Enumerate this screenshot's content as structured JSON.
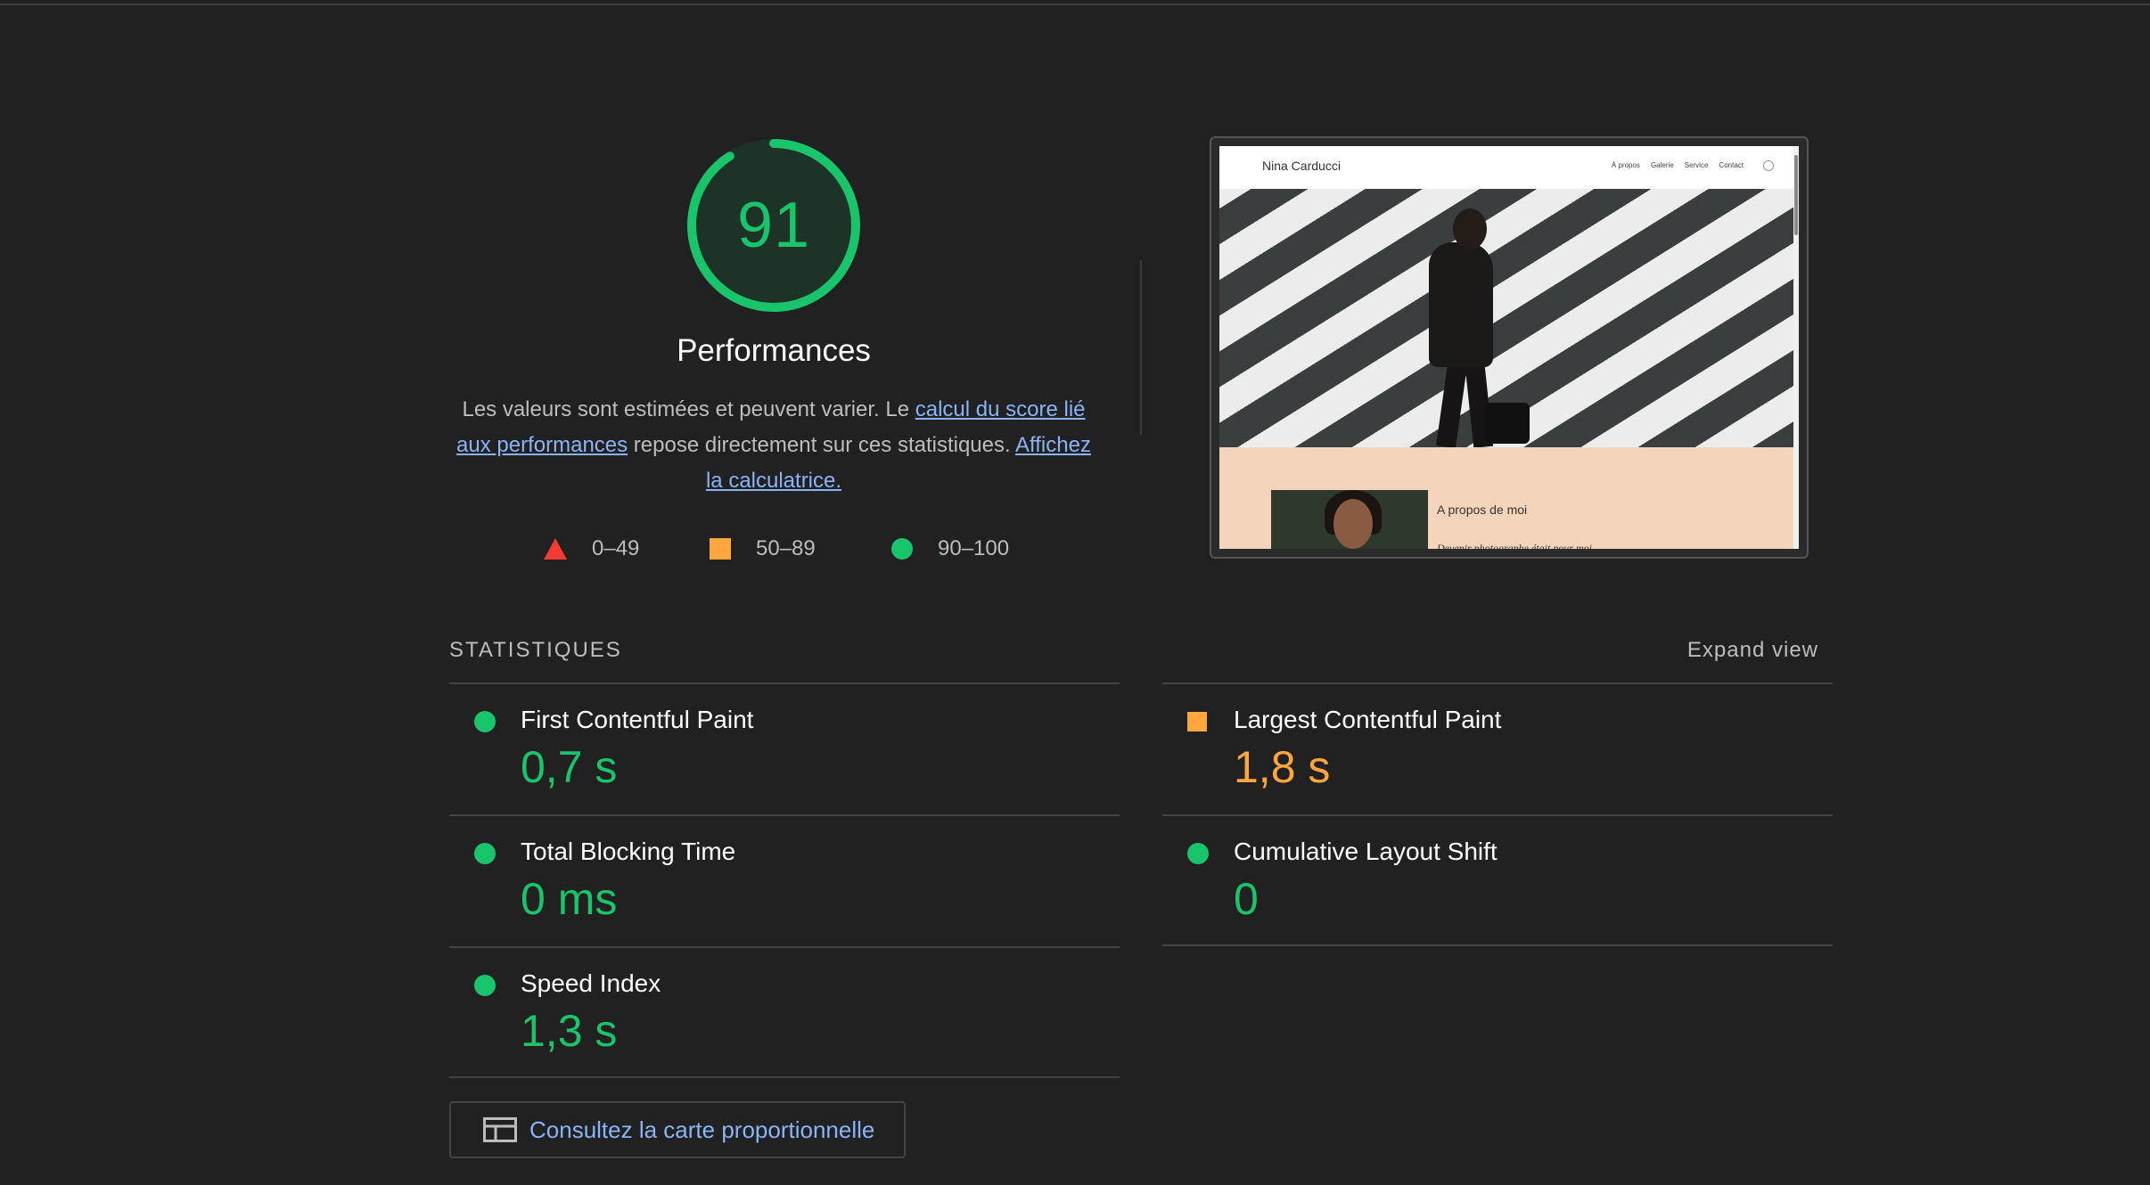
{
  "score": {
    "value": "91",
    "fraction": 0.91,
    "title": "Performances",
    "color": "#19c56a"
  },
  "description": {
    "part1": "Les valeurs sont estimées et peuvent varier. Le ",
    "link1": "calcul du score lié aux performances",
    "part2": " repose directement sur ces statistiques. ",
    "link2": "Affichez la calculatrice."
  },
  "legend": [
    {
      "range": "0–49",
      "shape": "triangle",
      "color": "#f33a33"
    },
    {
      "range": "50–89",
      "shape": "square",
      "color": "#ffa63d"
    },
    {
      "range": "90–100",
      "shape": "circle",
      "color": "#19c56a"
    }
  ],
  "preview": {
    "brand": "Nina Carducci",
    "nav": [
      "À propos",
      "Galerie",
      "Service",
      "Contact"
    ],
    "about_title": "A propos de moi",
    "about_sub": "Devenir photographe était pour moi"
  },
  "metrics": {
    "title": "STATISTIQUES",
    "expand_label": "Expand view",
    "items": [
      {
        "label": "First Contentful Paint",
        "value": "0,7 s",
        "status": "good"
      },
      {
        "label": "Largest Contentful Paint",
        "value": "1,8 s",
        "status": "average"
      },
      {
        "label": "Total Blocking Time",
        "value": "0 ms",
        "status": "good"
      },
      {
        "label": "Cumulative Layout Shift",
        "value": "0",
        "status": "good"
      },
      {
        "label": "Speed Index",
        "value": "1,3 s",
        "status": "good"
      }
    ]
  },
  "treemap_button": {
    "label": "Consultez la carte proportionnelle",
    "icon": "treemap-icon"
  }
}
